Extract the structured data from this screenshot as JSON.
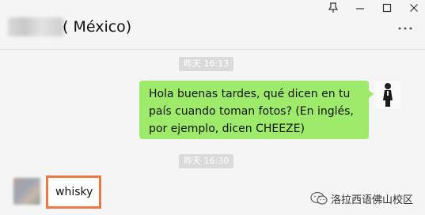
{
  "window": {
    "controls": {
      "pin": "ꝑ",
      "minimize": "–",
      "maximize": "□",
      "close": "✕"
    },
    "more_menu": "···"
  },
  "chat": {
    "title": "( México)"
  },
  "messages": [
    {
      "type": "timestamp",
      "text": "昨天 16:13"
    },
    {
      "type": "outgoing",
      "text": "Hola buenas tardes, qué dicen en tu país cuando toman fotos? (En inglés, por ejemplo, dicen CHEEZE)"
    },
    {
      "type": "timestamp",
      "text": "昨天 16:30"
    },
    {
      "type": "incoming",
      "text": "whisky"
    }
  ],
  "watermark": {
    "text": "洛拉西语佛山校区"
  },
  "colors": {
    "background": "#f5f5f5",
    "outgoing_bubble": "#9eea6a",
    "incoming_bubble": "#ffffff",
    "highlight": "#ec7845",
    "timestamp_bg": "#dadada"
  },
  "icons": {
    "pin": "pin-icon",
    "minimize": "minimize-icon",
    "maximize": "maximize-icon",
    "close": "close-icon",
    "more": "more-icon",
    "watermark_logo": "wechat-logo-icon"
  }
}
